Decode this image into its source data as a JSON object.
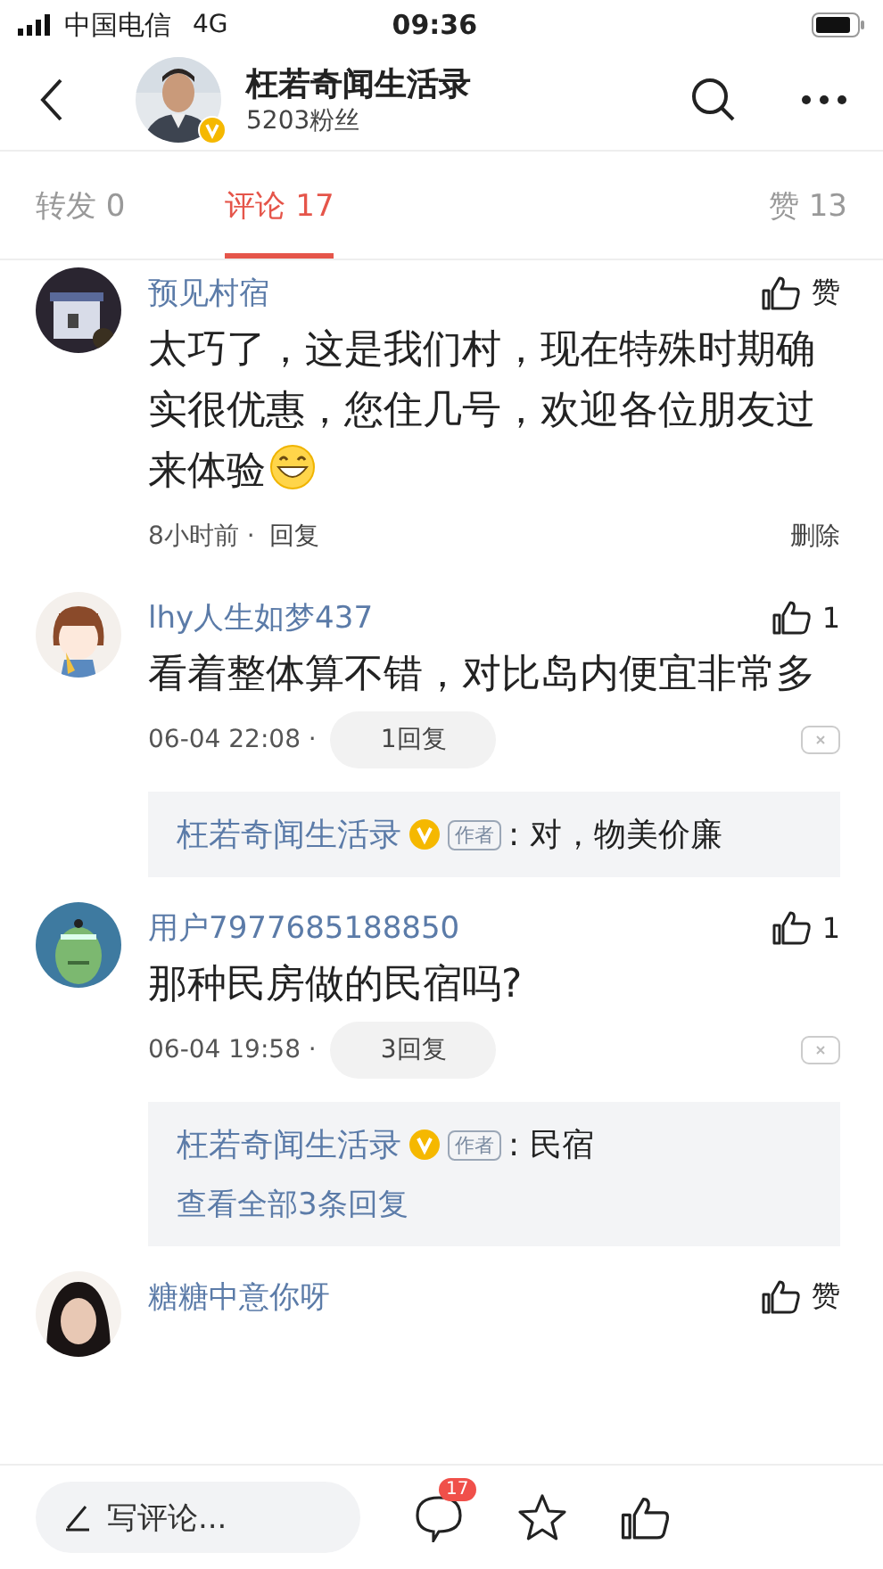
{
  "status_bar": {
    "carrier": "中国电信",
    "network": "4G",
    "time": "09:36"
  },
  "header": {
    "title": "枉若奇闻生活录",
    "followers": "5203粉丝",
    "verified": true
  },
  "tabs": [
    {
      "label": "转发 0",
      "selected": false
    },
    {
      "label": "评论 17",
      "selected": true
    },
    {
      "label": "赞 13",
      "selected": false
    }
  ],
  "comments": [
    {
      "name": "预见村宿",
      "likes": "赞",
      "text": "太巧了，这是我们村，现在特殊时期确实很优惠，您住几号，欢迎各位朋友过来体验",
      "emoji": true,
      "time": "8小时前 ·",
      "reply": "回复",
      "delete": "删除",
      "dismissable": false
    },
    {
      "name": "lhy人生如梦437",
      "likes": "1",
      "text": "看着整体算不错，对比岛内便宜非常多",
      "emoji": false,
      "time": "06-04 22:08 ·",
      "reply": "1回复",
      "dismissable": true,
      "replies": [
        {
          "author": "枉若奇闻生活录",
          "verified": true,
          "badge": "作者",
          "text": ": 对，物美价廉"
        }
      ]
    },
    {
      "name": "用户7977685188850",
      "likes": "1",
      "text": "那种民房做的民宿吗?",
      "emoji": false,
      "time": "06-04 19:58 ·",
      "reply": "3回复",
      "dismissable": true,
      "replies": [
        {
          "author": "枉若奇闻生活录",
          "verified": true,
          "badge": "作者",
          "text": ": 民宿"
        }
      ],
      "more": "查看全部3条回复"
    },
    {
      "name": "糖糖中意你呀",
      "likes": "赞"
    }
  ],
  "bottom_bar": {
    "placeholder": "写评论...",
    "comment_count": "17"
  }
}
